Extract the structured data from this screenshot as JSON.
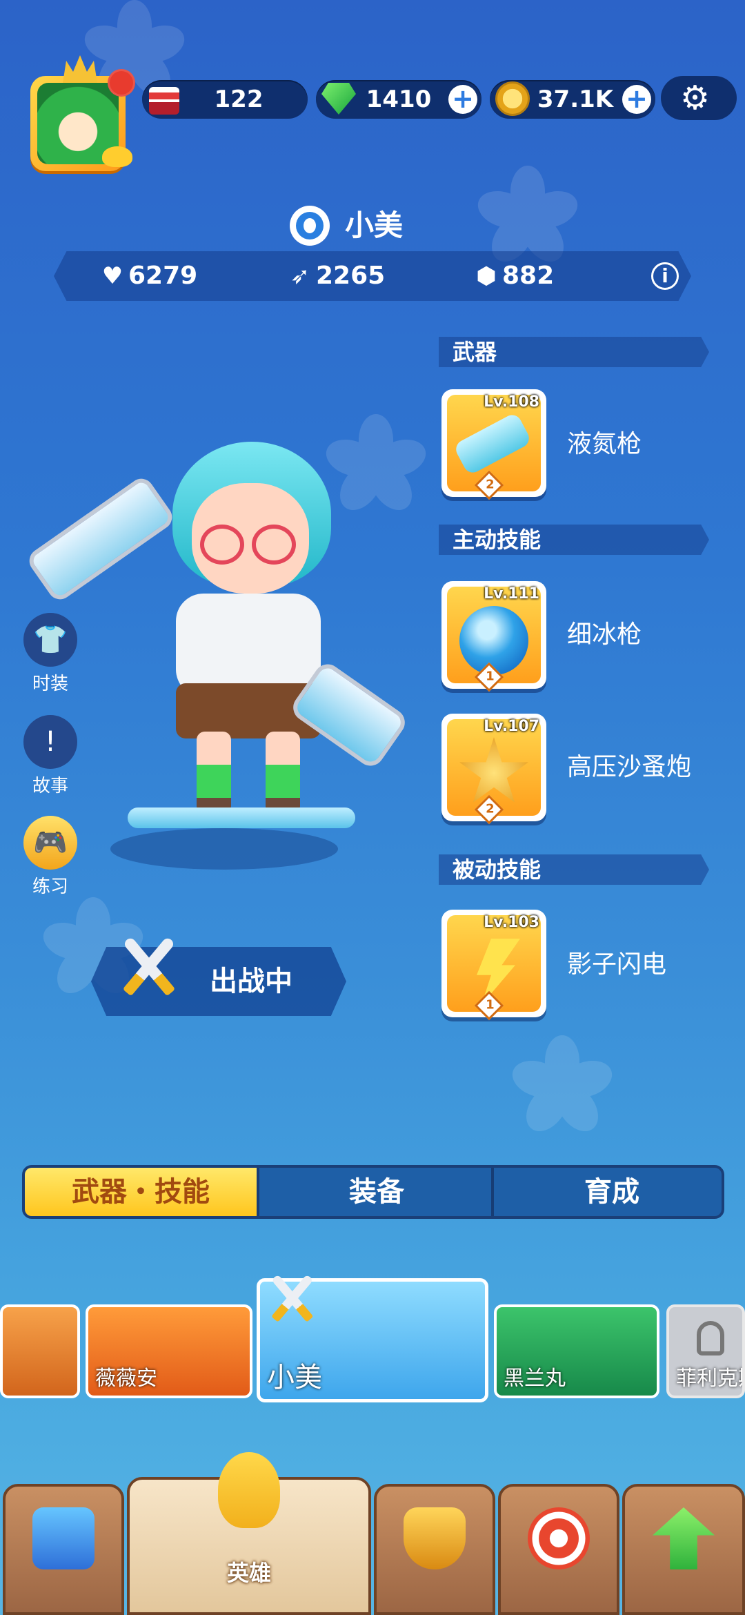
{
  "currency": {
    "tickets": "122",
    "gems": "1410",
    "coins": "37.1K"
  },
  "hero": {
    "name": "小美",
    "stats": {
      "hp": "6279",
      "attack": "2265",
      "defense": "882"
    },
    "deploy_label": "出战中"
  },
  "side_buttons": [
    "时装",
    "故事",
    "练习"
  ],
  "sections": {
    "weapon": {
      "title": "武器",
      "items": [
        {
          "level": "Lv.108",
          "name": "液氮枪",
          "rank": "2"
        }
      ]
    },
    "active": {
      "title": "主动技能",
      "items": [
        {
          "level": "Lv.111",
          "name": "细冰枪",
          "rank": "1"
        },
        {
          "level": "Lv.107",
          "name": "高压沙蚤炮",
          "rank": "2"
        }
      ]
    },
    "passive": {
      "title": "被动技能",
      "items": [
        {
          "level": "Lv.103",
          "name": "影子闪电",
          "rank": "1"
        }
      ]
    }
  },
  "tabs": [
    "武器・技能",
    "装备",
    "育成"
  ],
  "roster": [
    {
      "name": ""
    },
    {
      "name": "薇薇安"
    },
    {
      "name": "小美"
    },
    {
      "name": "黑兰丸"
    },
    {
      "name": "菲利克斯"
    }
  ],
  "bottom_nav": {
    "heroes": "英雄"
  },
  "colors": {
    "accent_tab": "#ffc61e",
    "card_gold": "#ff9f1c",
    "panel_dark": "#0f2f6e"
  }
}
